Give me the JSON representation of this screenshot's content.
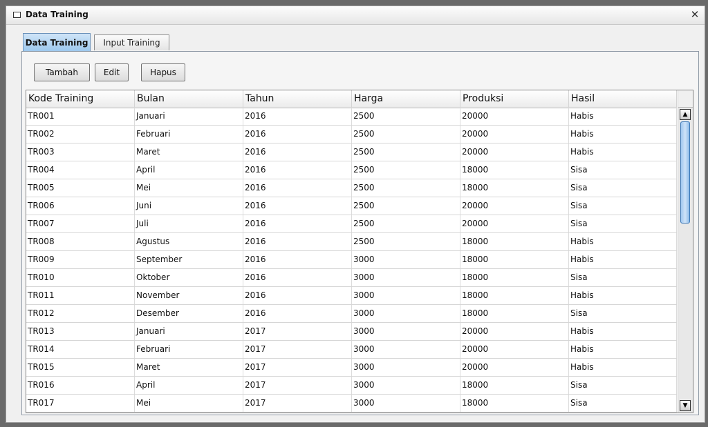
{
  "window": {
    "title": "Data Training"
  },
  "tabs": [
    {
      "label": "Data Training"
    },
    {
      "label": "Input Training"
    }
  ],
  "toolbar": {
    "add_label": "Tambah",
    "edit_label": "Edit",
    "delete_label": "Hapus"
  },
  "table": {
    "columns": [
      "Kode Training",
      "Bulan",
      "Tahun",
      "Harga",
      "Produksi",
      "Hasil"
    ],
    "rows": [
      [
        "TR001",
        "Januari",
        "2016",
        "2500",
        "20000",
        "Habis"
      ],
      [
        "TR002",
        "Februari",
        "2016",
        "2500",
        "20000",
        "Habis"
      ],
      [
        "TR003",
        "Maret",
        "2016",
        "2500",
        "20000",
        "Habis"
      ],
      [
        "TR004",
        "April",
        "2016",
        "2500",
        "18000",
        "Sisa"
      ],
      [
        "TR005",
        "Mei",
        "2016",
        "2500",
        "18000",
        "Sisa"
      ],
      [
        "TR006",
        "Juni",
        "2016",
        "2500",
        "20000",
        "Sisa"
      ],
      [
        "TR007",
        "Juli",
        "2016",
        "2500",
        "20000",
        "Sisa"
      ],
      [
        "TR008",
        "Agustus",
        "2016",
        "2500",
        "18000",
        "Habis"
      ],
      [
        "TR009",
        "September",
        "2016",
        "3000",
        "18000",
        "Habis"
      ],
      [
        "TR010",
        "Oktober",
        "2016",
        "3000",
        "18000",
        "Sisa"
      ],
      [
        "TR011",
        "November",
        "2016",
        "3000",
        "18000",
        "Habis"
      ],
      [
        "TR012",
        "Desember",
        "2016",
        "3000",
        "18000",
        "Sisa"
      ],
      [
        "TR013",
        "Januari",
        "2017",
        "3000",
        "20000",
        "Habis"
      ],
      [
        "TR014",
        "Februari",
        "2017",
        "3000",
        "20000",
        "Habis"
      ],
      [
        "TR015",
        "Maret",
        "2017",
        "3000",
        "20000",
        "Habis"
      ],
      [
        "TR016",
        "April",
        "2017",
        "3000",
        "18000",
        "Sisa"
      ],
      [
        "TR017",
        "Mei",
        "2017",
        "3000",
        "18000",
        "Sisa"
      ]
    ]
  },
  "scrollbar": {
    "up_icon": "▲",
    "down_icon": "▼"
  }
}
